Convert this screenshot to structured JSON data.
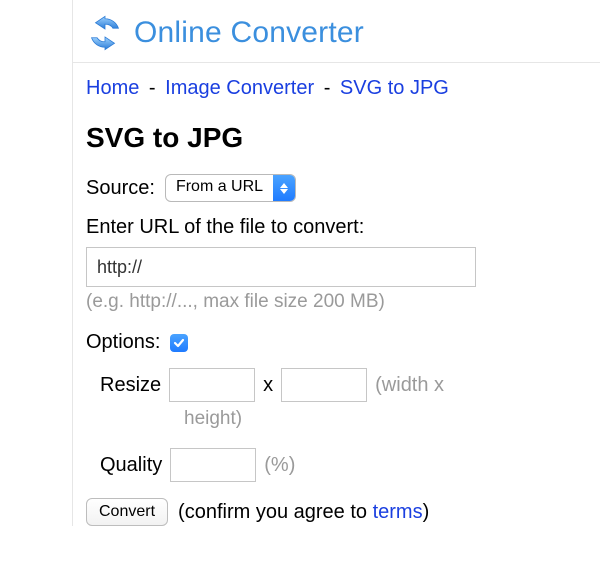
{
  "brand": {
    "title": "Online Converter",
    "icon": "refresh-arrows-icon"
  },
  "breadcrumb": {
    "items": [
      "Home",
      "Image Converter",
      "SVG to JPG"
    ],
    "sep": "-"
  },
  "page": {
    "title": "SVG to JPG"
  },
  "source": {
    "label": "Source:",
    "selected": "From a URL"
  },
  "url": {
    "label": "Enter URL of the file to convert:",
    "value": "http://",
    "hint": "(e.g. http://..., max file size 200 MB)"
  },
  "options": {
    "label": "Options:",
    "checked": true,
    "resize": {
      "label": "Resize",
      "x": "x",
      "width_value": "",
      "height_value": "",
      "unit_hint": "(width x",
      "sub_hint": "height)"
    },
    "quality": {
      "label": "Quality",
      "value": "",
      "unit": "(%)"
    }
  },
  "action": {
    "button": "Convert",
    "confirm_pre": "(confirm you agree to ",
    "terms": "terms",
    "confirm_post": ")"
  }
}
